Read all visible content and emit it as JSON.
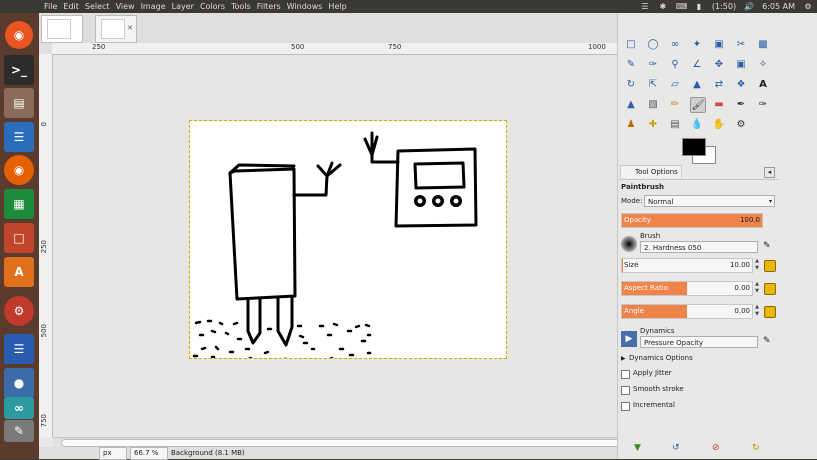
{
  "topbar": {
    "menus": [
      "File",
      "Edit",
      "Select",
      "View",
      "Image",
      "Layer",
      "Colors",
      "Tools",
      "Filters",
      "Windows",
      "Help"
    ],
    "battery": "(1:50)",
    "clock": "6:05 AM"
  },
  "launcher": {
    "apps": [
      "ubuntu-dash",
      "terminal",
      "files",
      "document-viewer",
      "firefox",
      "spreadsheet",
      "presentation",
      "software-center",
      "system-settings",
      "text-editor",
      "python",
      "arduino",
      "gimp"
    ]
  },
  "image_tabs": [
    "image-1",
    "image-2"
  ],
  "rulers": {
    "horizontal": [
      "250",
      "500",
      "750",
      "1000"
    ],
    "vertical": [
      "0",
      "250",
      "500",
      "750"
    ]
  },
  "statusbar": {
    "unit": "px",
    "zoom": "66.7 %",
    "layer_info": "Background (8.1 MB)"
  },
  "tool_options": {
    "tab_label": "Tool Options",
    "tool_name": "Paintbrush",
    "mode_label": "Mode:",
    "mode_value": "Normal",
    "opacity": {
      "label": "Opacity",
      "value": "100.0",
      "fraction": 1.0
    },
    "brush_label": "Brush",
    "brush_value": "2. Hardness 050",
    "size": {
      "label": "Size",
      "value": "10.00",
      "fraction": 0.01
    },
    "aspect_ratio": {
      "label": "Aspect Ratio",
      "value": "0.00",
      "fraction": 0.5
    },
    "angle": {
      "label": "Angle",
      "value": "0.00",
      "fraction": 0.5
    },
    "dynamics_label": "Dynamics",
    "dynamics_value": "Pressure Opacity",
    "dynamics_options": "Dynamics Options",
    "apply_jitter": "Apply Jitter",
    "smooth_stroke": "Smooth stroke",
    "incremental": "Incremental"
  },
  "colors": {
    "foreground": "#000000",
    "background": "#ffffff",
    "accent": "#f0834a"
  }
}
